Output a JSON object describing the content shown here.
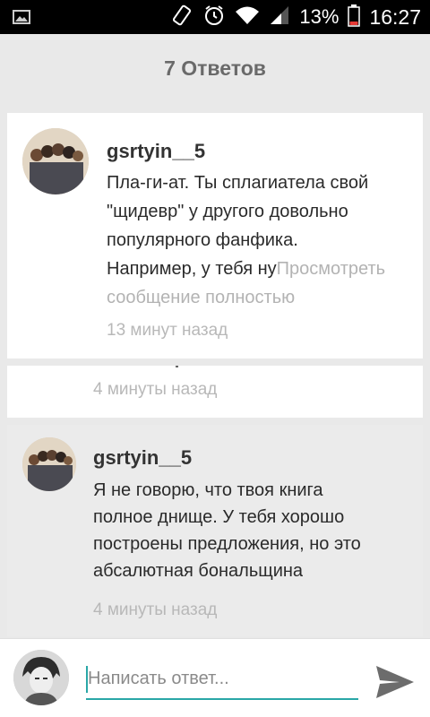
{
  "status_bar": {
    "battery": "13%",
    "time": "16:27"
  },
  "header": {
    "title": "7 Ответов"
  },
  "comments": [
    {
      "author": "gsrtyin__5",
      "text_lines": [
        "Пла-ги-ат.  Ты сплагиатела свой",
        "\"щидевр\" у другого довольно",
        "популярного фанфика."
      ],
      "text_tail": "Например, у тебя ну",
      "more_link_part1": "Просмотреть",
      "more_link_part2": "сообщение полностью",
      "time": "13 минут назад"
    },
    {
      "time": "4 минуты назад"
    },
    {
      "author": "gsrtyin__5",
      "text_lines": [
        "Я не говорю,  что твоя книга",
        "полное днище. У тебя хорошо",
        "построены предложения,  но это",
        "абсалютная бональщина"
      ],
      "time": "4 минуты назад"
    }
  ],
  "composer": {
    "placeholder": "Написать ответ..."
  }
}
